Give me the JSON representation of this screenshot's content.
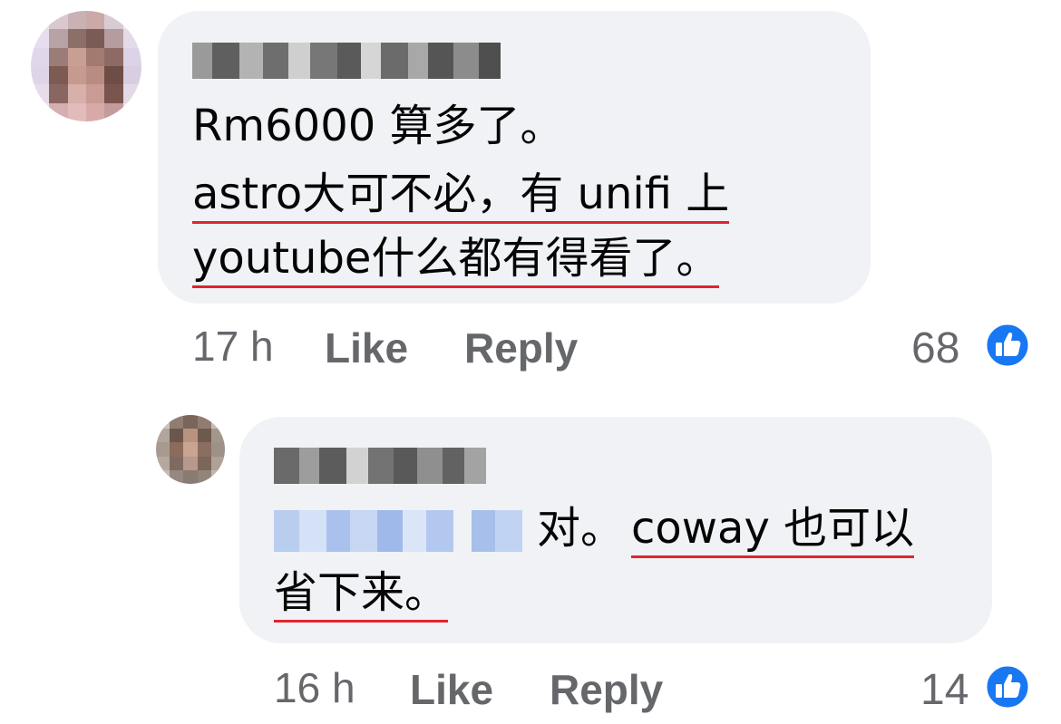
{
  "colors": {
    "bubble_bg": "#f0f2f5",
    "text": "#050505",
    "meta_text": "#65676b",
    "underline": "#e0242f",
    "like_blue": "#1877f2"
  },
  "comment1": {
    "author_name": "[blurred name]",
    "avatar_icon": "pixelated-avatar",
    "lines": [
      "Rm6000 算多了。",
      "astro大可不必，有 unifi 上",
      "youtube什么都有得看了。"
    ],
    "time": "17 h",
    "like_label": "Like",
    "reply_label": "Reply",
    "reaction_count": "68",
    "reaction_icon": "thumbs-up-icon"
  },
  "comment2": {
    "author_name": "[blurred name]",
    "avatar_icon": "pixelated-avatar",
    "mention": "[blurred mention]",
    "line1_plain": "对。",
    "line1_underlined": "coway 也可以",
    "line2_underlined": "省下来。",
    "time": "16 h",
    "like_label": "Like",
    "reply_label": "Reply",
    "reaction_count": "14",
    "reaction_icon": "thumbs-up-icon"
  }
}
